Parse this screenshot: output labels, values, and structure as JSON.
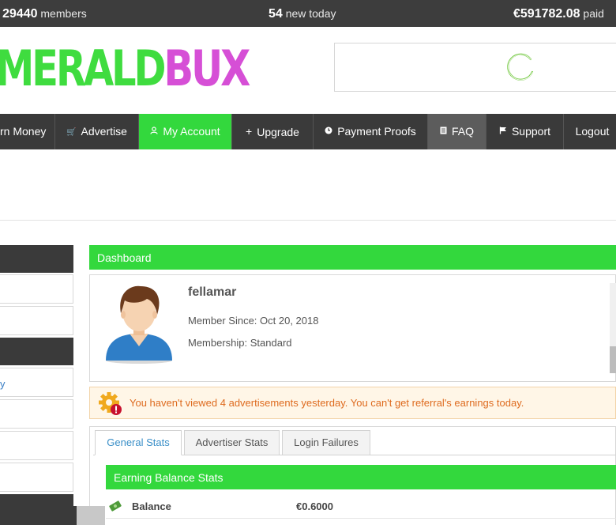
{
  "stats": {
    "members_count": "29440",
    "members_label": "members",
    "new_count": "54",
    "new_label": "new today",
    "paid_amount": "€591782.08",
    "paid_label": "paid"
  },
  "logo": {
    "part1": "MERALD",
    "part2": "BUX"
  },
  "nav": {
    "earn": "rn Money",
    "advertise": "Advertise",
    "my_account": "My Account",
    "upgrade": "Upgrade",
    "payment_proofs": "Payment Proofs",
    "faq": "FAQ",
    "support": "Support",
    "logout": "Logout"
  },
  "sidebar": {
    "item_3_label": "y"
  },
  "dashboard": {
    "title": "Dashboard",
    "username": "fellamar",
    "member_since": "Member Since: Oct 20, 2018",
    "membership": "Membership: Standard"
  },
  "warning": {
    "text": "You haven't viewed 4 advertisements yesterday. You can't get referral's earnings today."
  },
  "tabs": [
    "General Stats",
    "Advertiser Stats",
    "Login Failures"
  ],
  "earning": {
    "title": "Earning Balance Stats",
    "balance_label": "Balance",
    "balance_value": "€0.6000"
  },
  "colors": {
    "accent_green": "#33d83d",
    "logo_pink": "#d64fd6",
    "nav_dark": "#3a3a3a",
    "warning_text": "#de6b1f"
  }
}
